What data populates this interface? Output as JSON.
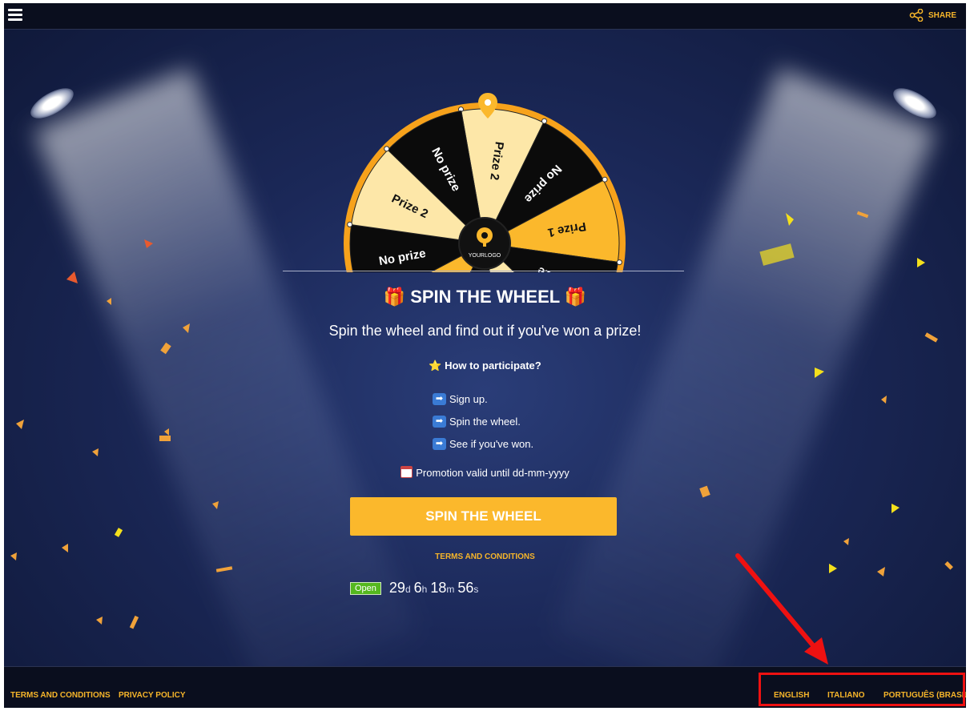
{
  "topbar": {
    "share_label": "SHARE"
  },
  "wheel": {
    "logo_text": "YOURLOGO",
    "segments": [
      "Prize 2",
      "No prize",
      "Prize 1",
      "No prize",
      "Prize 2",
      "No prize",
      "Prize 1",
      "No prize"
    ]
  },
  "main": {
    "title": "🎁 SPIN THE WHEEL 🎁",
    "subtitle": "Spin the wheel and find out if you've won a prize!",
    "howto": "⭐ How to participate?",
    "steps": [
      "Sign up.",
      "Spin the wheel.",
      "See if you've won."
    ],
    "promo": "Promotion valid until dd-mm-yyyy",
    "spin_button": "SPIN THE WHEEL",
    "terms_link": "TERMS AND CONDITIONS",
    "status_badge": "Open",
    "countdown": {
      "days": "29",
      "days_unit": "d",
      "hours": "6",
      "hours_unit": "h",
      "minutes": "18",
      "minutes_unit": "m",
      "seconds": "56",
      "seconds_unit": "s"
    }
  },
  "footer": {
    "terms": "TERMS AND CONDITIONS",
    "privacy": "PRIVACY POLICY",
    "languages": [
      "ENGLISH",
      "ITALIANO",
      "PORTUGUÊS (BRASIL)"
    ]
  },
  "colors": {
    "accent": "#fbb82c",
    "link": "#f6b52a",
    "open_badge": "#55b81f",
    "annotation": "#ee1111"
  }
}
